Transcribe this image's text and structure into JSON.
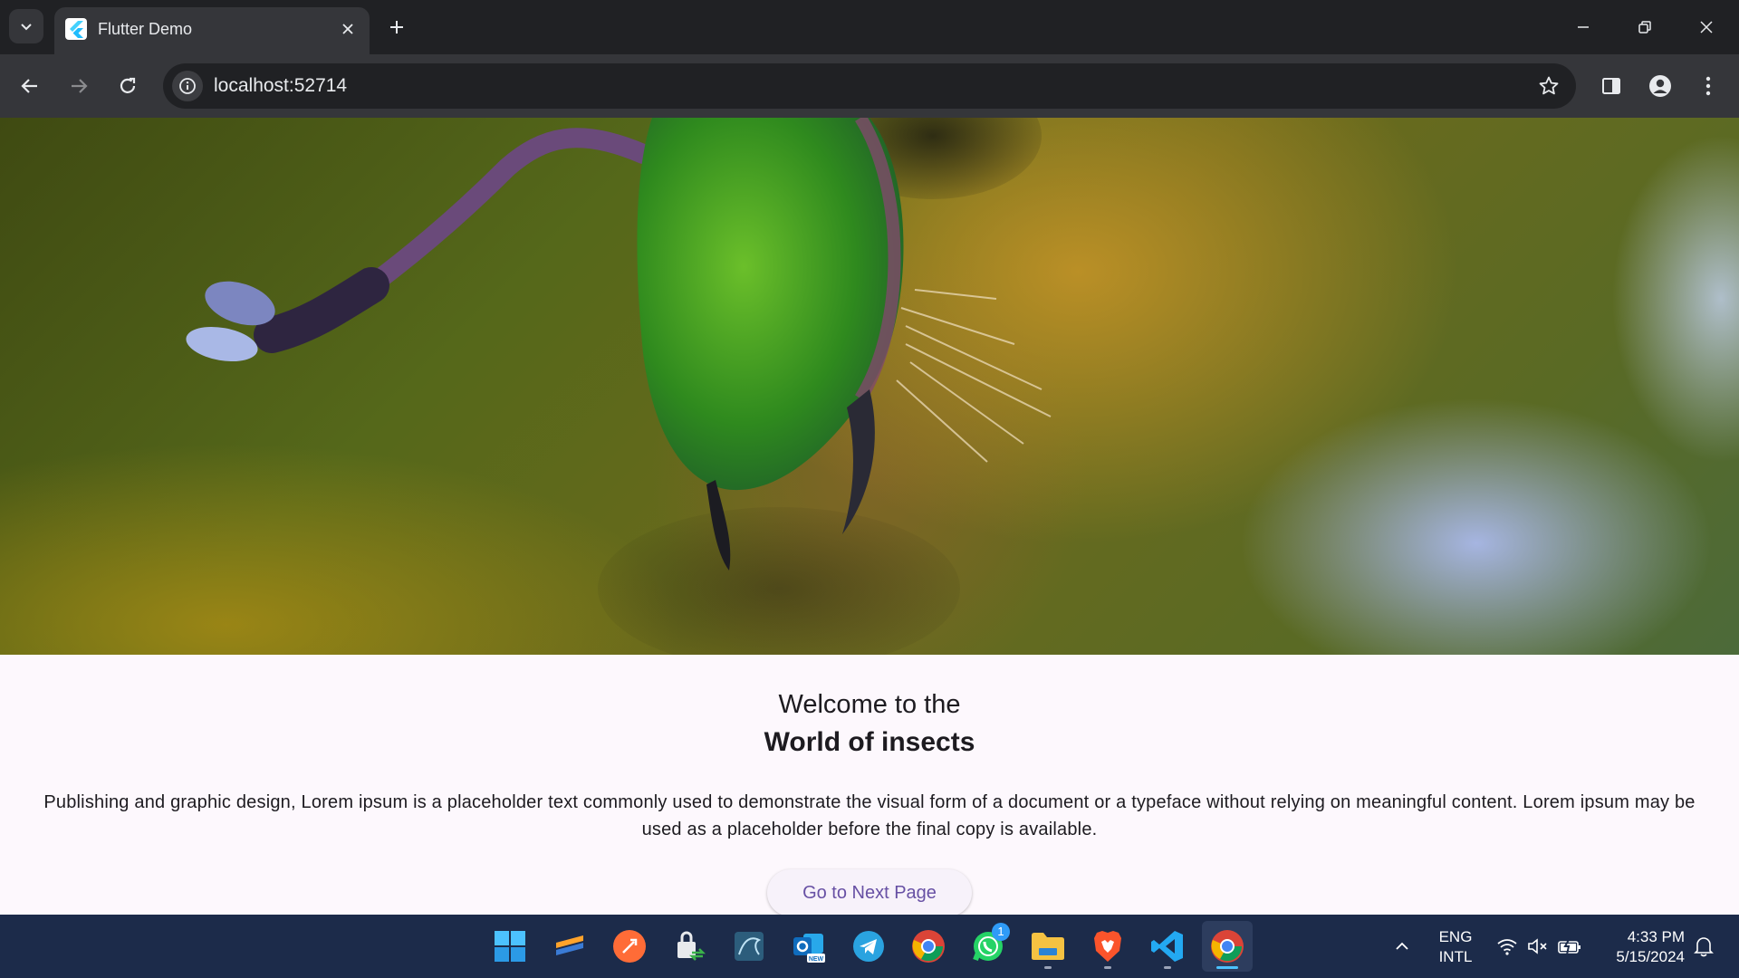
{
  "browser": {
    "tab_title": "Flutter Demo",
    "url": "localhost:52714",
    "icons": [
      "tab-search-icon",
      "flutter-favicon-icon",
      "close-icon",
      "plus-icon",
      "minimize-icon",
      "restore-icon",
      "close-window-icon",
      "back-arrow-icon",
      "forward-arrow-icon",
      "reload-icon",
      "info-icon",
      "star-icon",
      "side-panel-icon",
      "profile-icon",
      "kebab-menu-icon"
    ]
  },
  "page": {
    "welcome": "Welcome to the",
    "heading": "World of insects",
    "description": "Publishing and graphic design, Lorem ipsum is a placeholder text commonly used to demonstrate the visual form of a document or a typeface without relying on meaningful content. Lorem ipsum may be used as a placeholder before the final copy is available.",
    "button_label": "Go to Next Page"
  },
  "taskbar": {
    "apps": [
      "windows-start",
      "sublime-text",
      "postman",
      "file-transfer",
      "mysql-workbench",
      "outlook-new",
      "telegram",
      "google-chrome",
      "whatsapp",
      "file-explorer",
      "brave-browser",
      "vs-code",
      "google-chrome-active"
    ],
    "whatsapp_badge": "1",
    "language_line1": "ENG",
    "language_line2": "INTL",
    "time": "4:33 PM",
    "date": "5/15/2024"
  },
  "colors": {
    "accent": "#6750a4",
    "chrome_dark": "#202124",
    "chrome_toolbar": "#35363a",
    "taskbar": "#1c2b4a"
  }
}
